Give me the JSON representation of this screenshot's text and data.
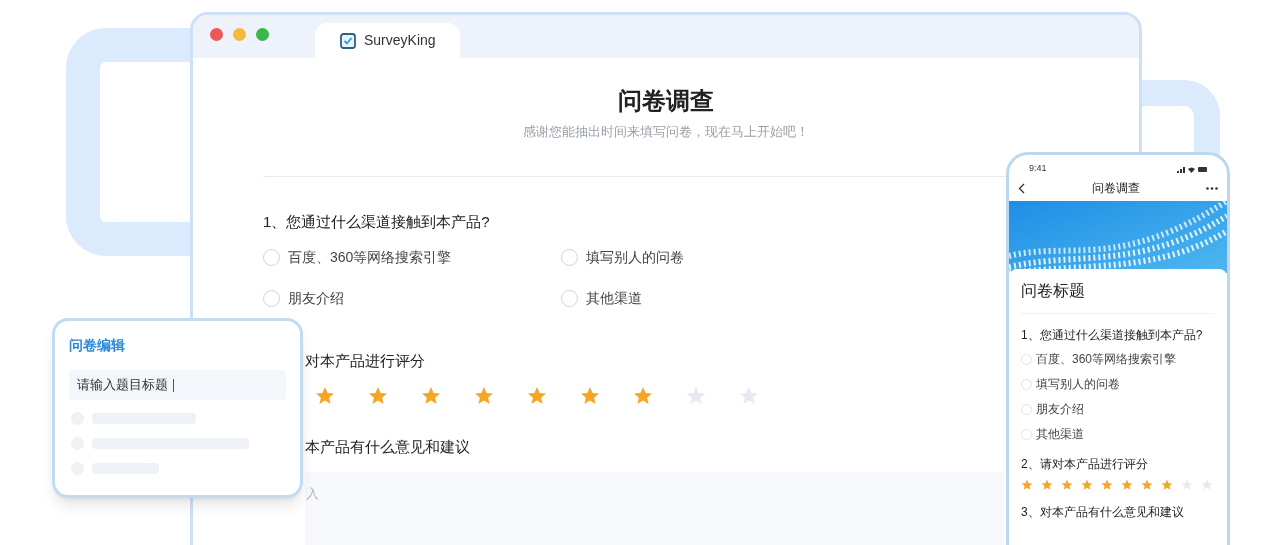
{
  "browser": {
    "tab": {
      "label": "SurveyKing",
      "selected": true
    }
  },
  "survey": {
    "title": "问卷调查",
    "subtitle": "感谢您能抽出时间来填写问卷，现在马上开始吧！",
    "questions": [
      {
        "kind": "choice",
        "title": "1、您通过什么渠道接触到本产品?",
        "options": [
          {
            "label": "百度、360等网络搜索引擎",
            "selected": false
          },
          {
            "label": "填写别人的问卷",
            "selected": false
          },
          {
            "label": "朋友介绍",
            "selected": false
          },
          {
            "label": "其他渠道",
            "selected": false
          }
        ]
      },
      {
        "kind": "rating",
        "title": "对本产品进行评分",
        "stars": 7
      },
      {
        "kind": "text",
        "title": "本产品有什么意见和建议",
        "placeholder": "入"
      }
    ]
  },
  "editor": {
    "title": "问卷编辑",
    "input_value": "请输入题目标题"
  },
  "phone": {
    "time": "9:41",
    "nav_title": "问卷调查",
    "card_title": "问卷标题",
    "questions": [
      {
        "kind": "choice",
        "title": "1、您通过什么渠道接触到本产品?",
        "options": [
          {
            "label": "百度、360等网络搜索引擎",
            "selected": false
          },
          {
            "label": "填写别人的问卷",
            "selected": false
          },
          {
            "label": "朋友介绍",
            "selected": false
          },
          {
            "label": "其他渠道",
            "selected": false
          }
        ]
      },
      {
        "kind": "rating",
        "title": "2、请对本产品进行评分",
        "stars": 8
      },
      {
        "kind": "text",
        "title": "3、对本产品有什么意见和建议"
      }
    ]
  }
}
